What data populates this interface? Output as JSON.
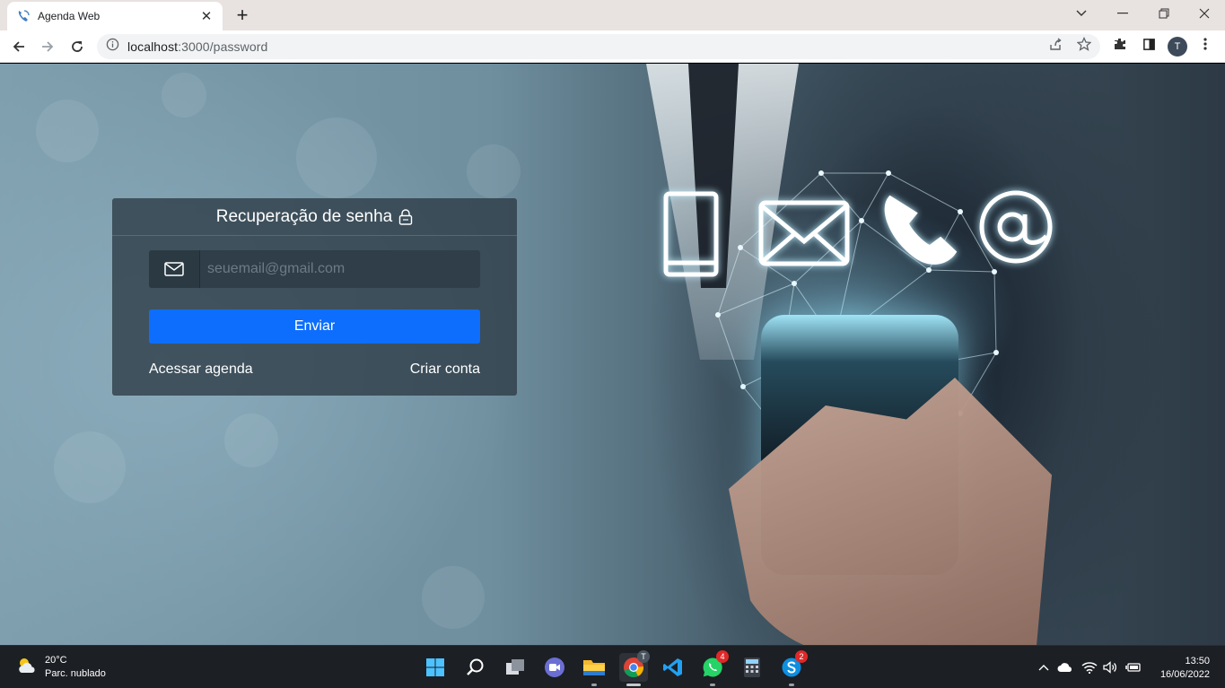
{
  "browser": {
    "tab_title": "Agenda Web",
    "url_host": "localhost",
    "url_path": ":3000/password",
    "avatar_initial": "T"
  },
  "card": {
    "title": "Recuperação de senha",
    "email_placeholder": "seuemail@gmail.com",
    "submit_label": "Enviar",
    "link_login": "Acessar agenda",
    "link_register": "Criar conta"
  },
  "colors": {
    "primary_button": "#0d6efd",
    "card_background": "#2c3a44",
    "badge": "#e02828"
  },
  "taskbar": {
    "weather_temp": "20°C",
    "weather_desc": "Parc. nublado",
    "whatsapp_badge": "4",
    "skype_badge": "2",
    "chrome_profile_badge": "T",
    "time": "13:50",
    "date": "16/06/2022"
  },
  "icons": [
    "envelope-icon",
    "lock-icon",
    "back-icon",
    "forward-icon",
    "reload-icon",
    "info-icon",
    "share-icon",
    "star-icon",
    "extensions-icon",
    "sidepanel-icon",
    "menu-icon"
  ]
}
